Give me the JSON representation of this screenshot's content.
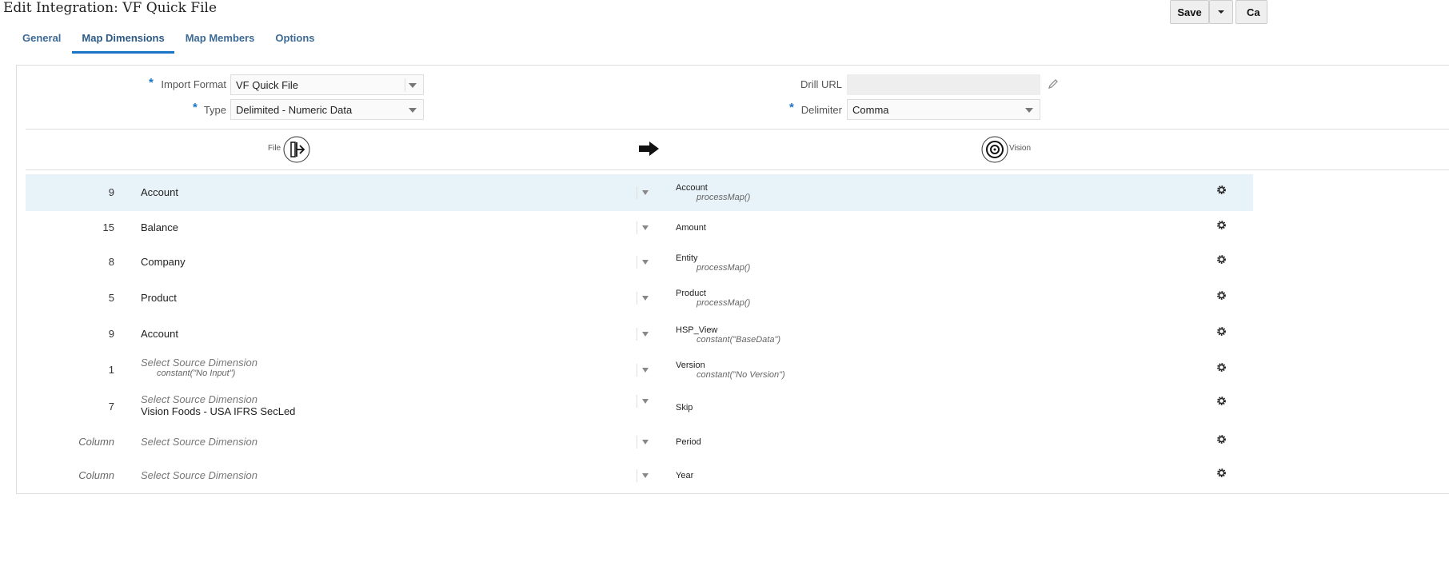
{
  "header": {
    "title": "Edit Integration: VF Quick File",
    "save_label": "Save",
    "cancel_label_partial": "Ca"
  },
  "tabs": [
    {
      "label": "General"
    },
    {
      "label": "Map Dimensions",
      "active": true
    },
    {
      "label": "Map Members"
    },
    {
      "label": "Options"
    }
  ],
  "form": {
    "import_format": {
      "label": "Import Format",
      "value": "VF Quick File"
    },
    "type": {
      "label": "Type",
      "value": "Delimited - Numeric Data"
    },
    "drill_url": {
      "label": "Drill URL",
      "value": ""
    },
    "delimiter": {
      "label": "Delimiter",
      "value": "Comma"
    },
    "required_mark": "*"
  },
  "columns": {
    "source": "File",
    "target": "Vision"
  },
  "colors": {
    "accent": "#1a74c4",
    "highlight": "#e8f2f9",
    "tab": "#3c6a95"
  },
  "rows": [
    {
      "num": "9",
      "source": "Account",
      "target": "Account",
      "target_expr": "processMap()"
    },
    {
      "num": "15",
      "source": "Balance",
      "target": "Amount"
    },
    {
      "num": "8",
      "source": "Company",
      "target": "Entity",
      "target_expr": "processMap()"
    },
    {
      "num": "5",
      "source": "Product",
      "target": "Product",
      "target_expr": "processMap()"
    },
    {
      "num": "9",
      "source": "Account",
      "target": "HSP_View",
      "target_expr": "constant(\"BaseData\")"
    },
    {
      "num": "1",
      "placeholder": "Select Source Dimension",
      "source_expr": "constant(\"No Input\")",
      "target": "Version",
      "target_expr": "constant(\"No Version\")"
    },
    {
      "num": "7",
      "placeholder": "Select Source Dimension",
      "source": "Vision Foods - USA IFRS SecLed",
      "target": "Skip"
    },
    {
      "num": "Column",
      "placeholder": "Select Source Dimension",
      "target": "Period"
    },
    {
      "num": "Column",
      "placeholder": "Select Source Dimension",
      "target": "Year"
    }
  ]
}
